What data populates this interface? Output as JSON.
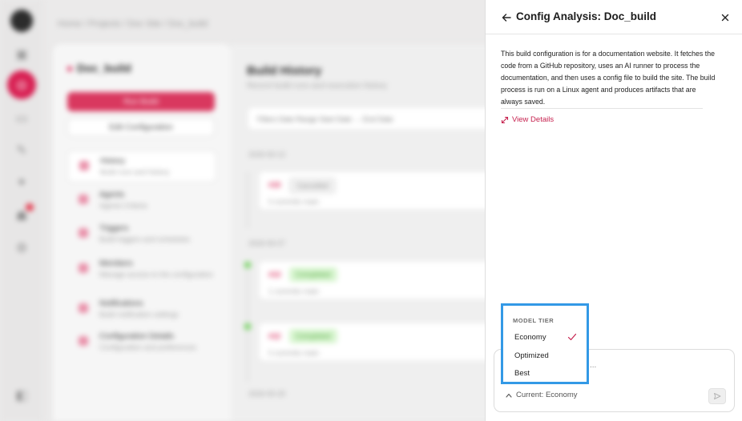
{
  "background": {
    "breadcrumb": "Home / Projects / Doc Site / Doc_build",
    "left_panel": {
      "title": "Doc_build",
      "run_label": "Run Build",
      "edit_label": "Edit Configuration",
      "nav": [
        {
          "title": "History",
          "subtitle": "Build runs and history"
        },
        {
          "title": "Agents",
          "subtitle": "Agents Criteria"
        },
        {
          "title": "Triggers",
          "subtitle": "Build triggers and schedules"
        },
        {
          "title": "Members",
          "subtitle": "Manage access to the configuration"
        },
        {
          "title": "Notifications",
          "subtitle": "Build notification settings"
        },
        {
          "title": "Configuration Details",
          "subtitle": "Configuration and preferences"
        }
      ]
    },
    "main": {
      "title": "Build History",
      "subtitle": "Recent build runs and execution history",
      "filter_text": "Filters   Date Range   Start Date   →   End Date",
      "groups": [
        {
          "date": "2026-06-13",
          "id": "#15",
          "status": "Cancelled",
          "meta": "0 commits   main"
        },
        {
          "date": "2026-06-07",
          "id": "#13",
          "status": "Completed",
          "meta": "1 commits   main"
        },
        {
          "date": "",
          "id": "#12",
          "status": "Completed",
          "meta": "0 commits   main"
        },
        {
          "date": "2026-05-29",
          "id": "",
          "status": "",
          "meta": ""
        }
      ]
    }
  },
  "panel": {
    "title": "Config Analysis: Doc_build",
    "description": "This build configuration is for a documentation website. It fetches the code from a GitHub repository, uses an AI runner to process the documentation, and then uses a config file to build the site. The build process is run on a Linux agent and produces artifacts that are always saved.",
    "view_details_label": "View Details",
    "input_ellipsis": "...",
    "current_tier_label": "Current: Economy",
    "model_tier_menu": {
      "label": "MODEL TIER",
      "options": [
        "Economy",
        "Optimized",
        "Best"
      ],
      "selected": "Economy"
    }
  },
  "colors": {
    "accent": "#d81f52",
    "link": "#c6224f",
    "menu_highlight_border": "#3399e6",
    "success": "#7cd36a"
  },
  "icons": {
    "back": "arrow-left-icon",
    "close": "close-icon",
    "details": "expand-arrows-icon",
    "check": "check-icon",
    "caret": "chevron-up-icon",
    "send": "send-icon"
  }
}
